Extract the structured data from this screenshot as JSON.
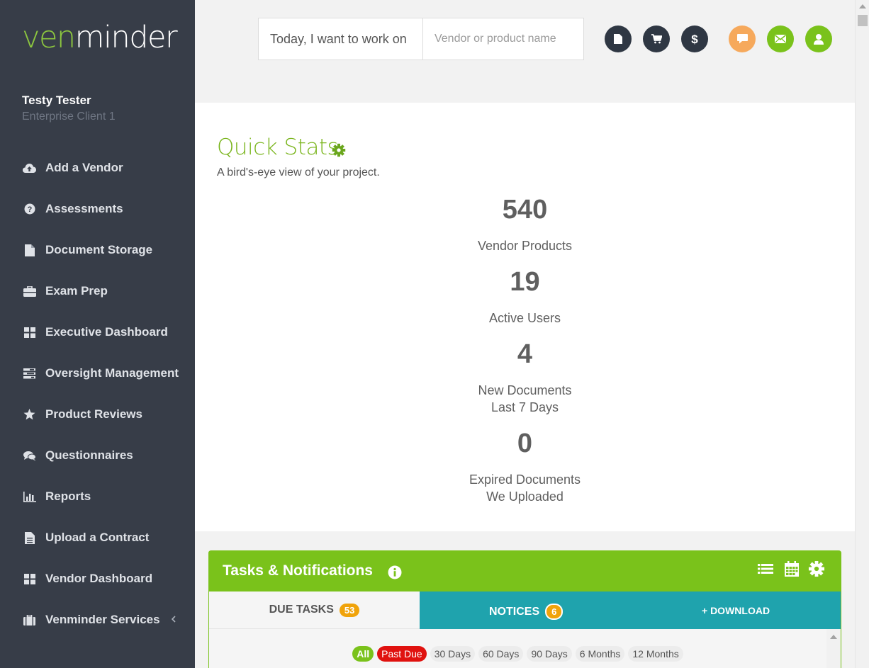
{
  "brand": {
    "part1": "ven",
    "part2": "minder"
  },
  "user": {
    "name": "Testy Tester",
    "org": "Enterprise Client 1"
  },
  "sidebar": {
    "items": [
      {
        "label": "Add a Vendor",
        "icon": "cloud-upload-icon"
      },
      {
        "label": "Assessments",
        "icon": "question-circle-icon"
      },
      {
        "label": "Document Storage",
        "icon": "file-icon"
      },
      {
        "label": "Exam Prep",
        "icon": "briefcase-icon"
      },
      {
        "label": "Executive Dashboard",
        "icon": "grid-icon"
      },
      {
        "label": "Oversight Management",
        "icon": "tasks-icon"
      },
      {
        "label": "Product Reviews",
        "icon": "star-icon"
      },
      {
        "label": "Questionnaires",
        "icon": "comments-icon"
      },
      {
        "label": "Reports",
        "icon": "bar-chart-icon"
      },
      {
        "label": "Upload a Contract",
        "icon": "file-text-icon"
      },
      {
        "label": "Vendor Dashboard",
        "icon": "grid-icon"
      },
      {
        "label": "Venminder Services",
        "icon": "suitcase-icon"
      }
    ]
  },
  "header": {
    "work_label": "Today, I want to work on",
    "search_placeholder": "Vendor or product name",
    "icons": [
      "document-icon",
      "cart-icon",
      "dollar-icon",
      "chat-icon",
      "mail-icon",
      "user-icon"
    ]
  },
  "quick_stats": {
    "title": "Quick Stats",
    "subtitle": "A bird's-eye view of your project.",
    "stats": [
      {
        "value": "540",
        "label1": "Vendor Products",
        "label2": ""
      },
      {
        "value": "19",
        "label1": "Active Users",
        "label2": ""
      },
      {
        "value": "4",
        "label1": "New Documents",
        "label2": "Last 7 Days"
      },
      {
        "value": "0",
        "label1": "Expired Documents",
        "label2": "We Uploaded"
      }
    ]
  },
  "tasks": {
    "title": "Tasks & Notifications",
    "due_label": "DUE TASKS",
    "due_count": "53",
    "notices_label": "NOTICES",
    "notices_count": "6",
    "download_label": "+ DOWNLOAD",
    "filters": [
      "All",
      "Past Due",
      "30 Days",
      "60 Days",
      "90 Days",
      "6 Months",
      "12 Months"
    ]
  },
  "colors": {
    "accent_green": "#7ac21b",
    "teal": "#1fa3ad",
    "sidebar_bg": "#373d48",
    "badge_orange": "#f0a30a",
    "past_due_red": "#e0120f"
  }
}
